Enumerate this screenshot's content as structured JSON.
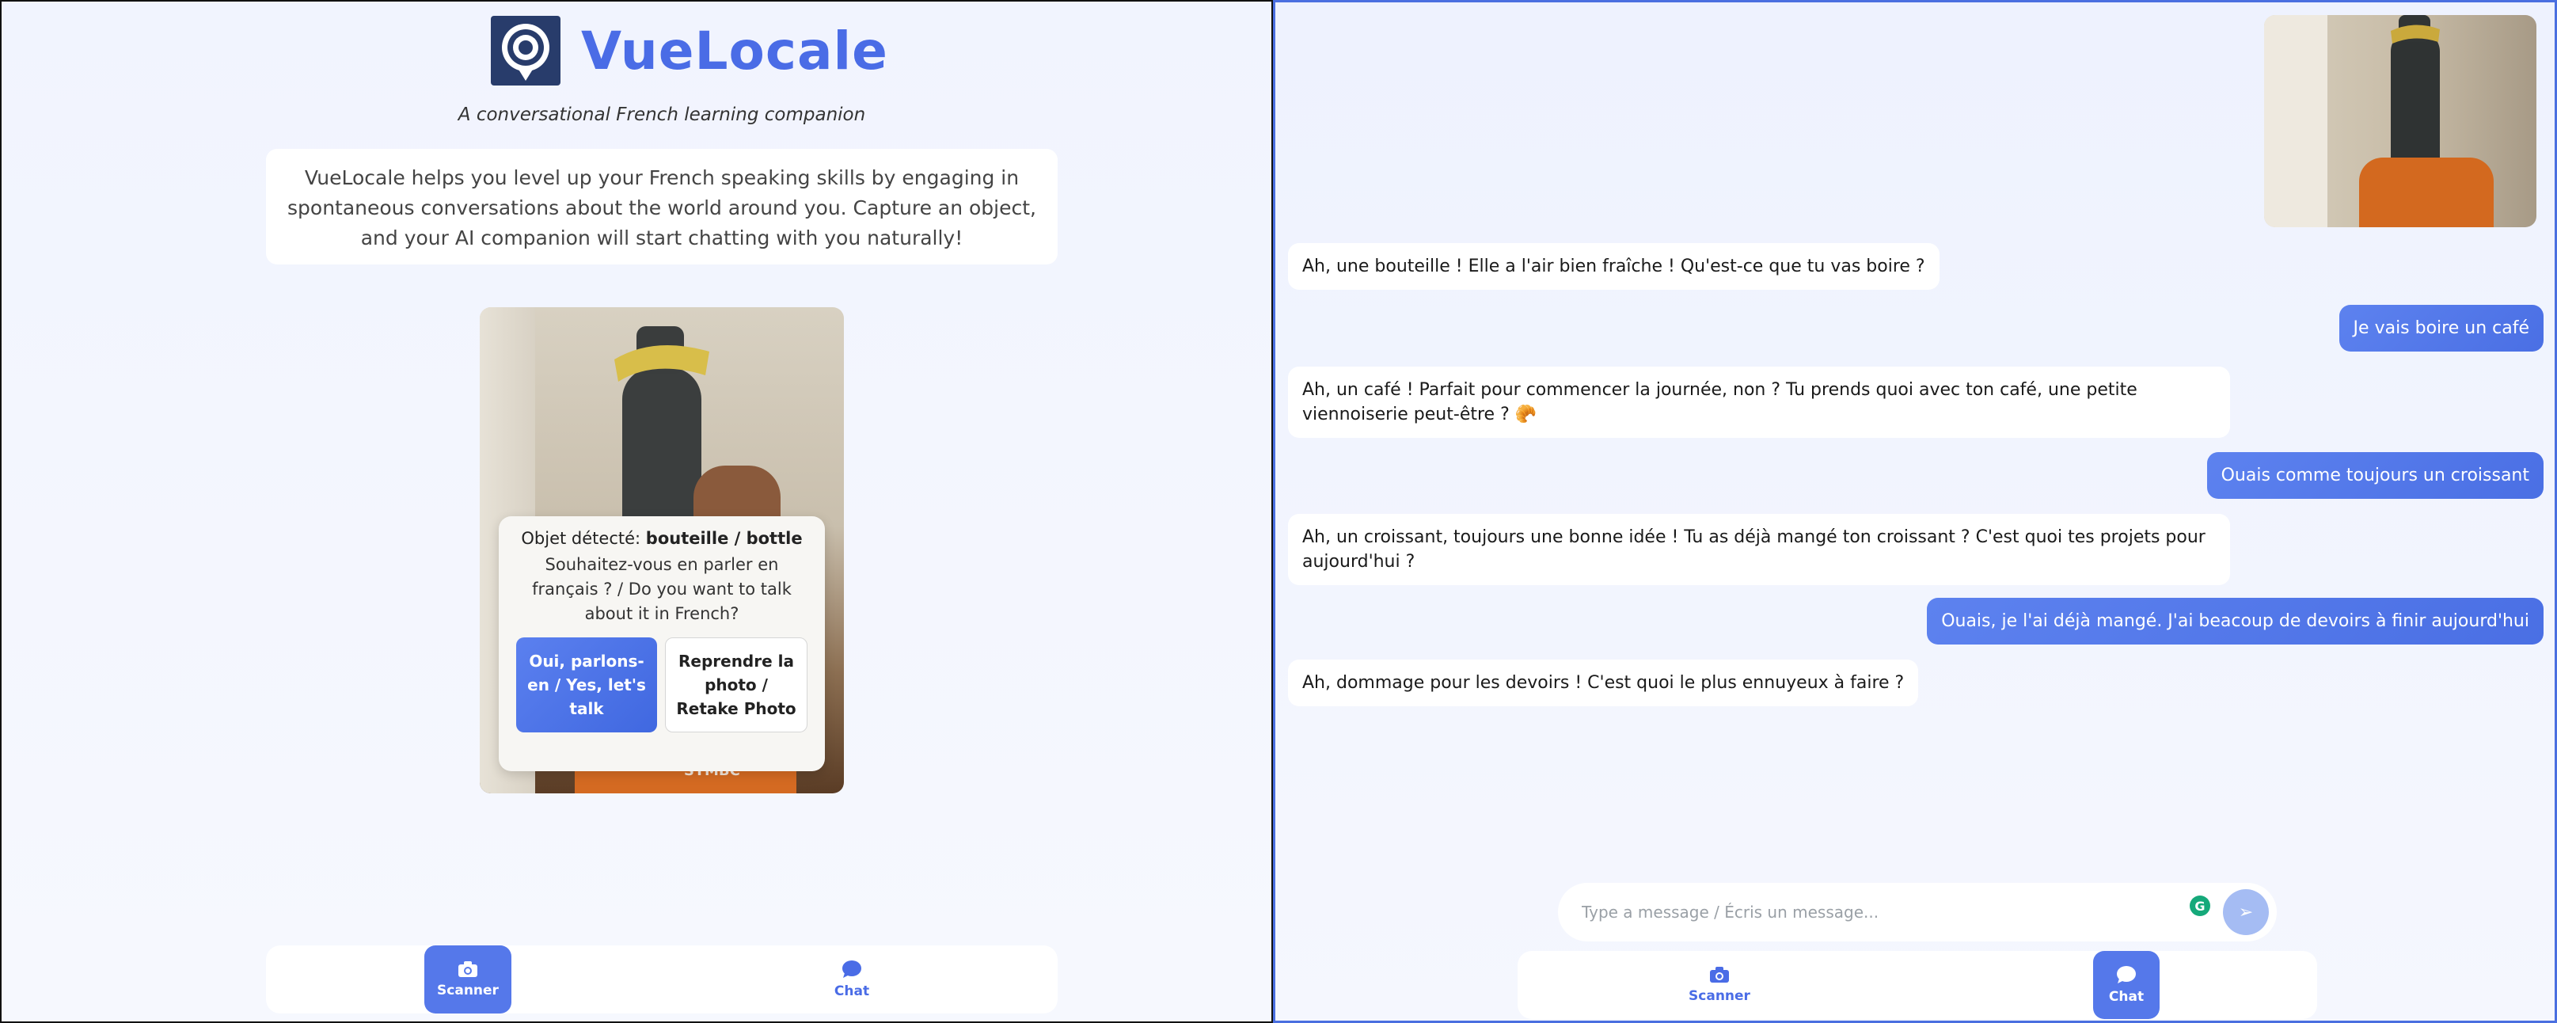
{
  "app": {
    "name": "VueLocale",
    "tagline": "A conversational French learning companion",
    "intro": "VueLocale helps you level up your French speaking skills by engaging in spontaneous conversations about the world around you. Capture an object, and your AI companion will start chatting with you naturally!"
  },
  "scanner": {
    "camera_overlay_text": "SYMBC",
    "dialog": {
      "detected_prefix": "Objet détecté: ",
      "detected_object": "bouteille / bottle",
      "question": "Souhaitez-vous en parler en français ? / Do you want to talk about it in French?",
      "confirm_label": "Oui, parlons-en / Yes, let's talk",
      "retake_label": "Reprendre la photo / Retake Photo"
    }
  },
  "chat": {
    "messages": [
      {
        "role": "bot",
        "text": "Ah, une bouteille ! Elle a l'air bien fraîche ! Qu'est-ce que tu vas boire ?"
      },
      {
        "role": "user",
        "text": "Je vais boire un café"
      },
      {
        "role": "bot",
        "text": "Ah, un café ! Parfait pour commencer la journée, non ? Tu prends quoi avec ton café, une petite viennoiserie peut-être ? 🥐"
      },
      {
        "role": "user",
        "text": "Ouais comme toujours un croissant"
      },
      {
        "role": "bot",
        "text": "Ah, un croissant, toujours une bonne idée ! Tu as déjà mangé ton croissant ? C'est quoi tes projets pour aujourd'hui ?"
      },
      {
        "role": "user",
        "text": "Ouais, je l'ai déjà mangé. J'ai beacoup de devoirs à finir aujourd'hui"
      },
      {
        "role": "bot",
        "text": "Ah, dommage pour les devoirs ! C'est quoi le plus ennuyeux à faire ?"
      }
    ],
    "composer": {
      "placeholder": "Type a message / Écris un message...",
      "value": "",
      "send_symbol": "➢",
      "grammarly_symbol": "G"
    }
  },
  "nav": {
    "scanner_label": "Scanner",
    "chat_label": "Chat"
  },
  "colors": {
    "accent": "#4a6ce6",
    "user_bubble": "#5578ea",
    "send_button": "#a5bcf3"
  },
  "icons": {
    "logo": "target-pin-logo",
    "scanner": "camera-icon",
    "chat": "chat-bubble-icon",
    "send": "send-icon"
  }
}
